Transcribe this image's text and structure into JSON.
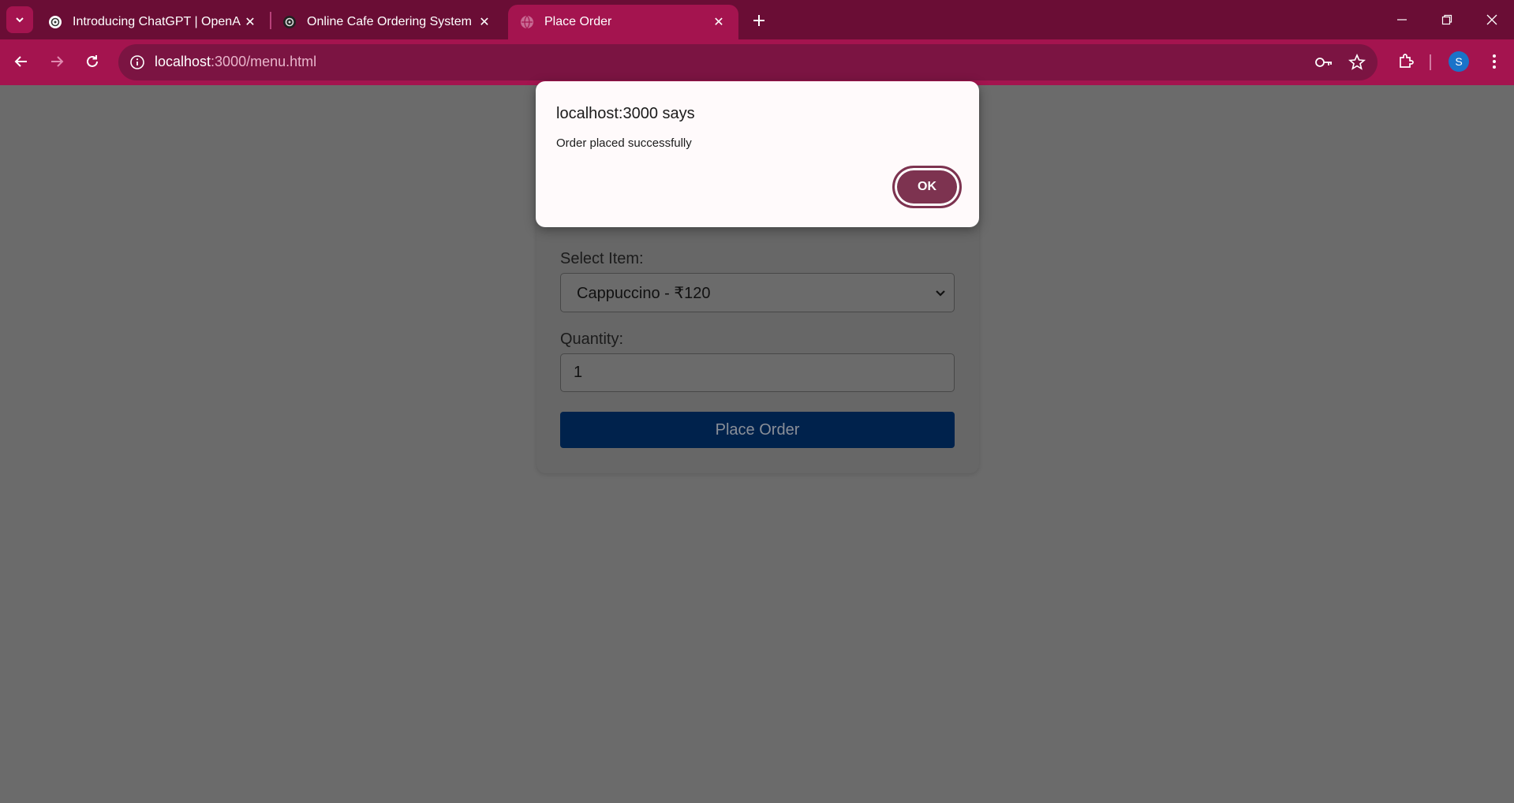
{
  "browser": {
    "tabs": [
      {
        "title": "Introducing ChatGPT | OpenAI",
        "icon": "openai-icon",
        "active": false
      },
      {
        "title": "Online Cafe Ordering System",
        "icon": "openai-icon",
        "active": false
      },
      {
        "title": "Place Order",
        "icon": "globe-icon",
        "active": true
      }
    ],
    "url_host": "localhost",
    "url_path": ":3000/menu.html",
    "profile_initial": "S",
    "colors": {
      "tabbar": "#6a0d35",
      "toolbar": "#a4144f",
      "omnibox": "#7b1442"
    }
  },
  "form": {
    "select_label": "Select Item:",
    "selected_item": "Cappuccino - ₹120",
    "quantity_label": "Quantity:",
    "quantity_value": "1",
    "submit_label": "Place Order"
  },
  "dialog": {
    "title": "localhost:3000 says",
    "message": "Order placed successfully",
    "ok_label": "OK",
    "accent": "#7d3350"
  }
}
